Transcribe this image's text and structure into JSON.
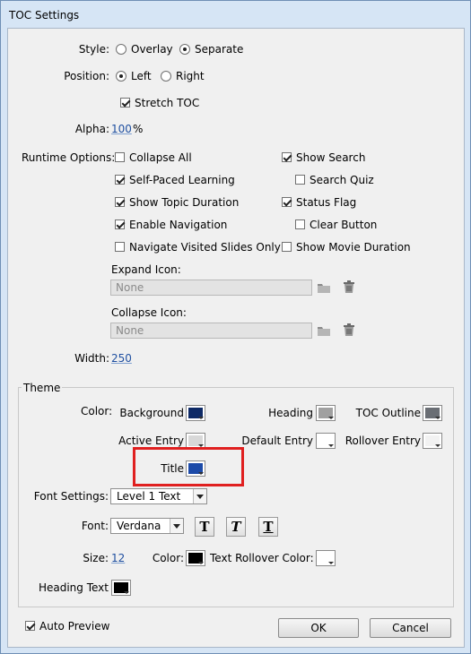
{
  "window": {
    "title": "TOC Settings"
  },
  "style": {
    "label": "Style:",
    "options": [
      "Overlay",
      "Separate"
    ],
    "selected": "Separate"
  },
  "position": {
    "label": "Position:",
    "options": [
      "Left",
      "Right"
    ],
    "selected": "Left"
  },
  "stretch_toc": {
    "label": "Stretch TOC",
    "checked": true
  },
  "alpha": {
    "label": "Alpha:",
    "value": "100",
    "unit": "%"
  },
  "runtime": {
    "label": "Runtime Options:",
    "items": [
      {
        "label": "Collapse All",
        "checked": false
      },
      {
        "label": "Show Search",
        "checked": true
      },
      {
        "label": "Self-Paced Learning",
        "checked": true
      },
      {
        "label": "Search Quiz",
        "checked": false
      },
      {
        "label": "Show Topic Duration",
        "checked": true
      },
      {
        "label": "Status Flag",
        "checked": true
      },
      {
        "label": "Enable Navigation",
        "checked": true
      },
      {
        "label": "Clear Button",
        "checked": false
      },
      {
        "label": "Navigate Visited Slides Only",
        "checked": false
      },
      {
        "label": "Show Movie Duration",
        "checked": false
      }
    ]
  },
  "expand_icon": {
    "label": "Expand Icon:",
    "value": "None"
  },
  "collapse_icon": {
    "label": "Collapse Icon:",
    "value": "None"
  },
  "width": {
    "label": "Width:",
    "value": "250"
  },
  "theme": {
    "label": "Theme",
    "color_label": "Color:",
    "swatches": {
      "background": {
        "label": "Background",
        "color": "#0e2a66"
      },
      "heading": {
        "label": "Heading",
        "color": "#a0a0a0"
      },
      "toc_outline": {
        "label": "TOC Outline",
        "color": "#6a6e74"
      },
      "active_entry": {
        "label": "Active Entry",
        "color": "#d8d8d8"
      },
      "default_entry": {
        "label": "Default Entry",
        "color": "#ffffff"
      },
      "rollover_entry": {
        "label": "Rollover Entry",
        "color": "#f2f2f2"
      },
      "title": {
        "label": "Title",
        "color": "#1c4aa8"
      }
    },
    "font_settings": {
      "label": "Font Settings:",
      "value": "Level 1 Text"
    },
    "font": {
      "label": "Font:",
      "value": "Verdana",
      "bold": "T",
      "italic": "T",
      "underline": "T"
    },
    "size": {
      "label": "Size:",
      "value": "12"
    },
    "text_color": {
      "label": "Color:",
      "color": "#000000"
    },
    "text_rollover": {
      "label": "Text Rollover Color:",
      "color": "#ffffff"
    },
    "heading_text": {
      "label": "Heading Text",
      "color": "#000000"
    }
  },
  "auto_preview": {
    "label": "Auto Preview",
    "checked": true
  },
  "buttons": {
    "ok": "OK",
    "cancel": "Cancel"
  },
  "colors": {
    "highlight_box": "#e02020",
    "link_blue": "#1f4fa0"
  }
}
